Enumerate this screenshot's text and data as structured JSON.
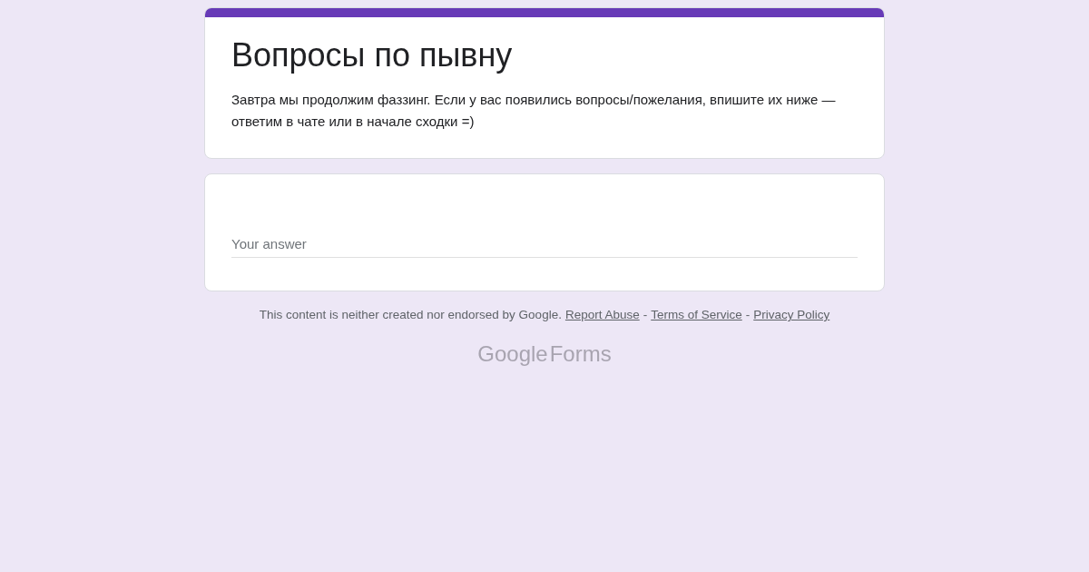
{
  "form": {
    "title": "Вопросы по пывну",
    "description": "Завтра мы продолжим фаззинг. Если у вас появились вопросы/пожелания, впишите их ниже — ответим в чате или в начале сходки =)"
  },
  "question": {
    "placeholder": "Your answer"
  },
  "footer": {
    "parts": [
      {
        "kind": "text",
        "text": "This content is neither created nor endorsed by Google."
      },
      {
        "kind": "link",
        "text": "Report Abuse"
      },
      {
        "kind": "text",
        "text": "-"
      },
      {
        "kind": "link",
        "text": "Terms of Service"
      },
      {
        "kind": "text",
        "text": "-"
      },
      {
        "kind": "link",
        "text": "Privacy Policy"
      }
    ]
  },
  "logo": {
    "brand": "Google",
    "product": "Forms"
  }
}
